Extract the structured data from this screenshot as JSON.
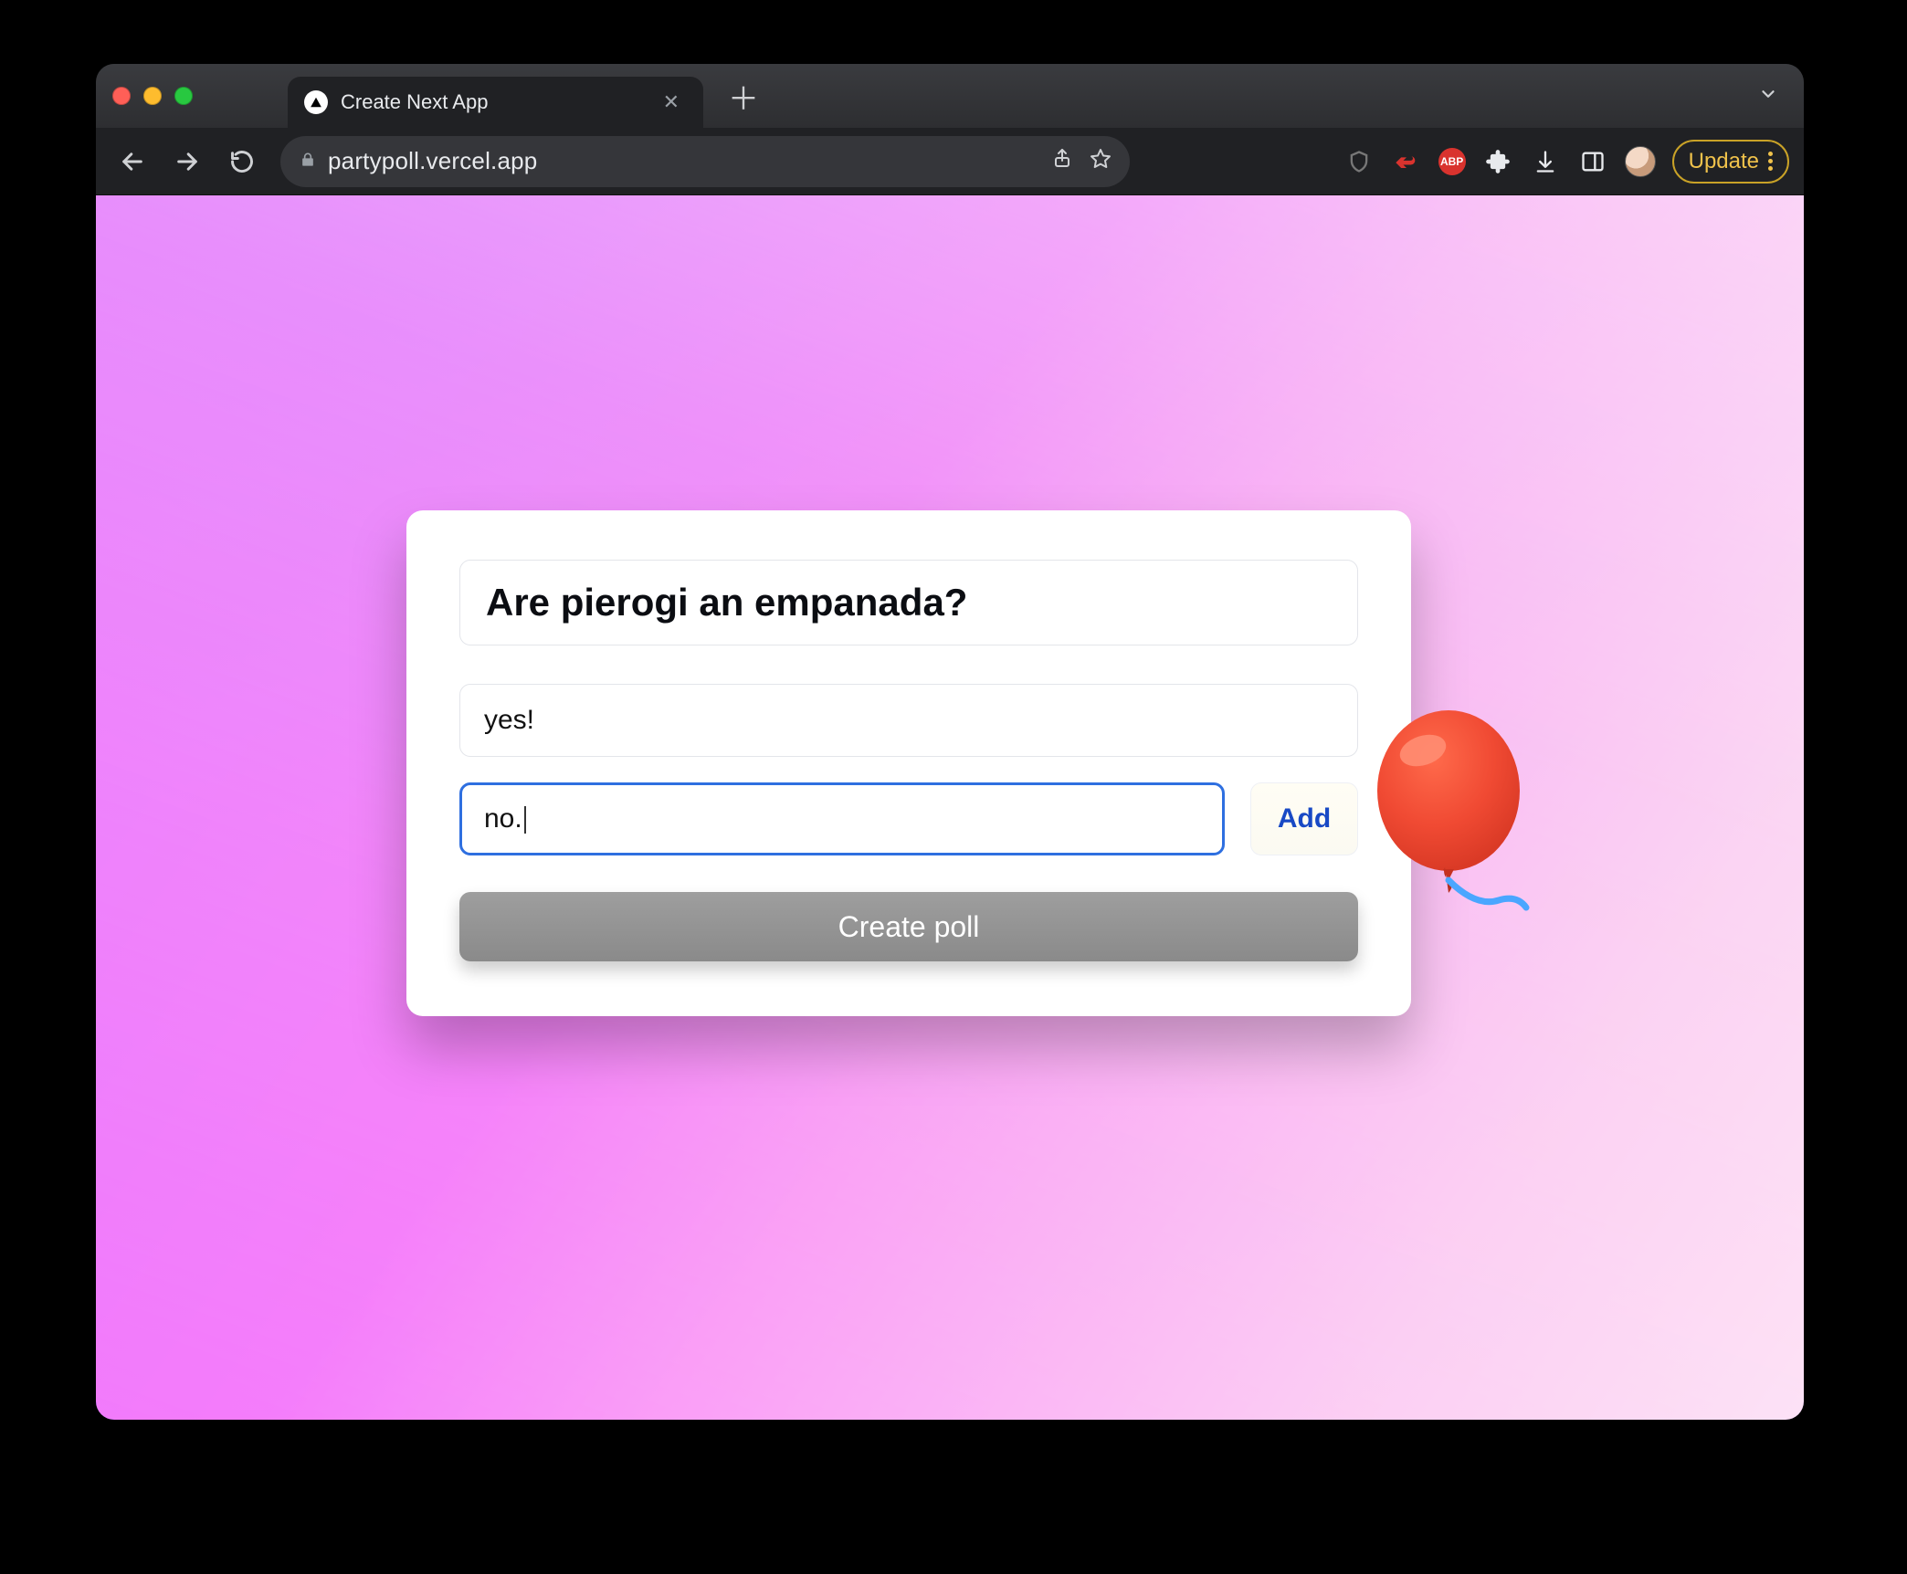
{
  "tab": {
    "title": "Create Next App"
  },
  "omnibox": {
    "url": "partypoll.vercel.app"
  },
  "browser": {
    "update_label": "Update",
    "abp_label": "ABP"
  },
  "poll": {
    "question": "Are pierogi an empanada?",
    "answers": [
      "yes!"
    ],
    "new_answer": "no.",
    "add_label": "Add",
    "create_label": "Create poll"
  }
}
